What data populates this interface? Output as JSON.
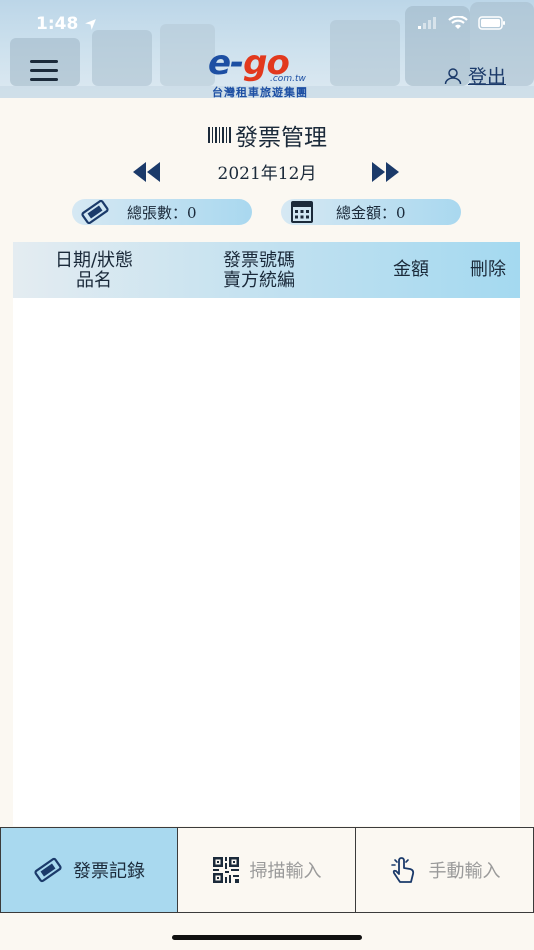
{
  "status_bar": {
    "time": "1:48"
  },
  "header": {
    "logo_text_e": "e-",
    "logo_text_go": "go",
    "logo_domain": ".com.tw",
    "logo_subtitle": "台灣租車旅遊集團",
    "logout_label": "登出"
  },
  "page": {
    "title": "發票管理",
    "month": "2021年12月"
  },
  "summary": {
    "count_label": "總張數：0",
    "amount_label": "總金額：0"
  },
  "table": {
    "headers": {
      "col1_line1": "日期/狀態",
      "col1_line2": "品名",
      "col2_line1": "發票號碼",
      "col2_line2": "賣方統編",
      "col3": "金額",
      "col4": "刪除"
    },
    "rows": []
  },
  "tabs": [
    {
      "label": "發票記錄",
      "icon": "ticket-icon",
      "active": true
    },
    {
      "label": "掃描輸入",
      "icon": "qr-code-icon",
      "active": false
    },
    {
      "label": "手動輸入",
      "icon": "hand-tap-icon",
      "active": false
    }
  ],
  "colors": {
    "accent_blue": "#a9d9ef",
    "logo_blue": "#1d4fa3",
    "logo_red": "#e2391d",
    "text_dark": "#1b2a3a"
  }
}
